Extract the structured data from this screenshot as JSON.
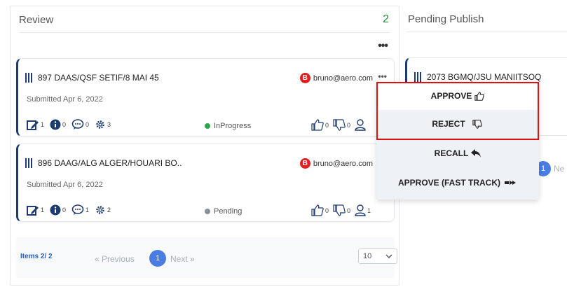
{
  "review": {
    "title": "Review",
    "count": "2",
    "more": "•••"
  },
  "cards": [
    {
      "id": "897 DAAS/QSF SETIF/8 MAI 45",
      "submitted": "Submitted Apr 6, 2022",
      "user_badge": "B",
      "user": "bruno@aero.com",
      "more": "•••",
      "edit_count": "1",
      "info_count": "0",
      "comment_count": "0",
      "settings_count": "3",
      "status": "InProgress",
      "status_color": "#2fa84f",
      "likes": "0",
      "dislikes": "0",
      "reviewers": ""
    },
    {
      "id": "896 DAAG/ALG ALGER/HOUARI BO..",
      "submitted": "Submitted Apr 6, 2022",
      "user_badge": "B",
      "user": "bruno@aero.com",
      "edit_count": "1",
      "info_count": "0",
      "comment_count": "1",
      "settings_count": "2",
      "status": "Pending",
      "status_color": "#8a8f96",
      "likes": "0",
      "dislikes": "0",
      "reviewers": "1"
    }
  ],
  "pager": {
    "items": "Items 2/ 2",
    "prev": "« Previous",
    "page": "1",
    "next": "Next »",
    "page_size": "10"
  },
  "pending": {
    "title": "Pending Publish",
    "card_id": "2073 BGMQ/JSU MANIITSOQ",
    "page": "1",
    "next": "Ne"
  },
  "menu": {
    "approve": "APPROVE",
    "reject": "REJECT",
    "recall": "RECALL",
    "fast_track": "APPROVE (FAST TRACK)"
  }
}
